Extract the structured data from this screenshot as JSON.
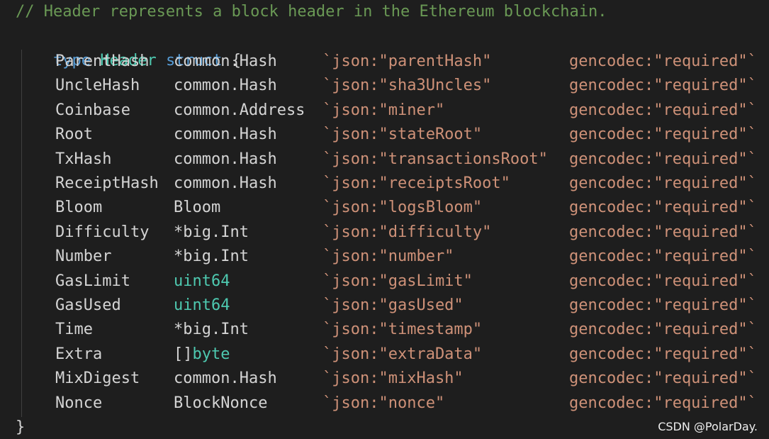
{
  "code": {
    "comment": "// Header represents a block header in the Ethereum blockchain.",
    "decl": {
      "type_kw": "type",
      "name": "Header",
      "struct_kw": "struct",
      "open": "{"
    },
    "fields": [
      {
        "name": "ParentHash",
        "type": "common.Hash",
        "type_kind": "plain",
        "json": "`json:\"parentHash\"",
        "gencodec": "gencodec:\"required\"`"
      },
      {
        "name": "UncleHash",
        "type": "common.Hash",
        "type_kind": "plain",
        "json": "`json:\"sha3Uncles\"",
        "gencodec": "gencodec:\"required\"`"
      },
      {
        "name": "Coinbase",
        "type": "common.Address",
        "type_kind": "plain",
        "json": "`json:\"miner\"",
        "gencodec": "gencodec:\"required\"`"
      },
      {
        "name": "Root",
        "type": "common.Hash",
        "type_kind": "plain",
        "json": "`json:\"stateRoot\"",
        "gencodec": "gencodec:\"required\"`"
      },
      {
        "name": "TxHash",
        "type": "common.Hash",
        "type_kind": "plain",
        "json": "`json:\"transactionsRoot\"",
        "gencodec": "gencodec:\"required\"`"
      },
      {
        "name": "ReceiptHash",
        "type": "common.Hash",
        "type_kind": "plain",
        "json": "`json:\"receiptsRoot\"",
        "gencodec": "gencodec:\"required\"`"
      },
      {
        "name": "Bloom",
        "type": "Bloom",
        "type_kind": "plain",
        "json": "`json:\"logsBloom\"",
        "gencodec": "gencodec:\"required\"`"
      },
      {
        "name": "Difficulty",
        "type": "*big.Int",
        "type_kind": "plain",
        "json": "`json:\"difficulty\"",
        "gencodec": "gencodec:\"required\"`"
      },
      {
        "name": "Number",
        "type": "*big.Int",
        "type_kind": "plain",
        "json": "`json:\"number\"",
        "gencodec": "gencodec:\"required\"`"
      },
      {
        "name": "GasLimit",
        "type": "uint64",
        "type_kind": "builtin",
        "json": "`json:\"gasLimit\"",
        "gencodec": "gencodec:\"required\"`"
      },
      {
        "name": "GasUsed",
        "type": "uint64",
        "type_kind": "builtin",
        "json": "`json:\"gasUsed\"",
        "gencodec": "gencodec:\"required\"`"
      },
      {
        "name": "Time",
        "type": "*big.Int",
        "type_kind": "plain",
        "json": "`json:\"timestamp\"",
        "gencodec": "gencodec:\"required\"`"
      },
      {
        "name": "Extra",
        "type_prefix": "[]",
        "type": "byte",
        "type_kind": "builtin",
        "json": "`json:\"extraData\"",
        "gencodec": "gencodec:\"required\"`"
      },
      {
        "name": "MixDigest",
        "type": "common.Hash",
        "type_kind": "plain",
        "json": "`json:\"mixHash\"",
        "gencodec": "gencodec:\"required\"`"
      },
      {
        "name": "Nonce",
        "type": "BlockNonce",
        "type_kind": "plain",
        "json": "`json:\"nonce\"",
        "gencodec": "gencodec:\"required\"`"
      }
    ],
    "close": "}"
  },
  "watermark": "CSDN @PolarDay.",
  "colors": {
    "background": "#1e1e1e",
    "comment": "#6a9955",
    "keyword": "#569cd6",
    "type": "#4ec9b0",
    "text": "#d4d4d4",
    "string": "#ce9178"
  }
}
